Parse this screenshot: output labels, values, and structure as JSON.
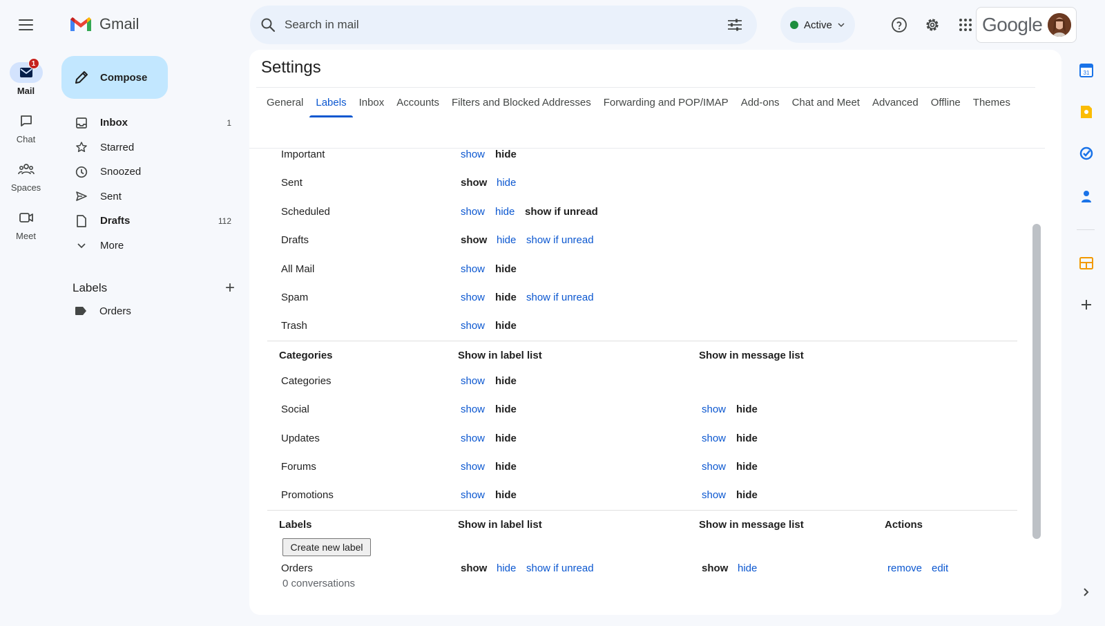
{
  "app": {
    "name": "Gmail"
  },
  "rail": {
    "items": [
      {
        "label": "Mail",
        "badge": "1"
      },
      {
        "label": "Chat"
      },
      {
        "label": "Spaces"
      },
      {
        "label": "Meet"
      }
    ]
  },
  "compose": {
    "label": "Compose"
  },
  "nav": {
    "items": [
      {
        "label": "Inbox",
        "count": "1",
        "icon": "inbox-icon"
      },
      {
        "label": "Starred",
        "count": "",
        "icon": "star-icon"
      },
      {
        "label": "Snoozed",
        "count": "",
        "icon": "clock-icon"
      },
      {
        "label": "Sent",
        "count": "",
        "icon": "send-icon"
      },
      {
        "label": "Drafts",
        "count": "112",
        "icon": "draft-icon"
      },
      {
        "label": "More",
        "count": "",
        "icon": "chevron-down-icon"
      }
    ]
  },
  "labels": {
    "title": "Labels",
    "items": [
      {
        "label": "Orders"
      }
    ]
  },
  "search": {
    "placeholder": "Search in mail"
  },
  "status": {
    "label": "Active",
    "color": "#1e8e3e"
  },
  "account": {
    "brand": "Google"
  },
  "settings": {
    "title": "Settings",
    "tabs": [
      "General",
      "Labels",
      "Inbox",
      "Accounts",
      "Filters and Blocked Addresses",
      "Forwarding and POP/IMAP",
      "Add-ons",
      "Chat and Meet",
      "Advanced",
      "Offline",
      "Themes"
    ],
    "active_tab": "Labels",
    "system_labels": [
      {
        "name": "Important",
        "options": [
          "show",
          "hide"
        ],
        "selected": "hide"
      },
      {
        "name": "Sent",
        "options": [
          "show",
          "hide"
        ],
        "selected": "show"
      },
      {
        "name": "Scheduled",
        "options": [
          "show",
          "hide",
          "show if unread"
        ],
        "selected": "show if unread"
      },
      {
        "name": "Drafts",
        "options": [
          "show",
          "hide",
          "show if unread"
        ],
        "selected": "show"
      },
      {
        "name": "All Mail",
        "options": [
          "show",
          "hide"
        ],
        "selected": "hide"
      },
      {
        "name": "Spam",
        "options": [
          "show",
          "hide",
          "show if unread"
        ],
        "selected": "hide"
      },
      {
        "name": "Trash",
        "options": [
          "show",
          "hide"
        ],
        "selected": "hide"
      }
    ],
    "categories": {
      "header": {
        "name": "Categories",
        "label_list": "Show in label list",
        "message_list": "Show in message list"
      },
      "rows": [
        {
          "name": "Categories",
          "label_options": [
            "show",
            "hide"
          ],
          "label_selected": "hide",
          "message_options": [],
          "message_selected": ""
        },
        {
          "name": "Social",
          "label_options": [
            "show",
            "hide"
          ],
          "label_selected": "hide",
          "message_options": [
            "show",
            "hide"
          ],
          "message_selected": "hide"
        },
        {
          "name": "Updates",
          "label_options": [
            "show",
            "hide"
          ],
          "label_selected": "hide",
          "message_options": [
            "show",
            "hide"
          ],
          "message_selected": "hide"
        },
        {
          "name": "Forums",
          "label_options": [
            "show",
            "hide"
          ],
          "label_selected": "hide",
          "message_options": [
            "show",
            "hide"
          ],
          "message_selected": "hide"
        },
        {
          "name": "Promotions",
          "label_options": [
            "show",
            "hide"
          ],
          "label_selected": "hide",
          "message_options": [
            "show",
            "hide"
          ],
          "message_selected": "hide"
        }
      ]
    },
    "user_labels": {
      "header": {
        "name": "Labels",
        "label_list": "Show in label list",
        "message_list": "Show in message list",
        "actions": "Actions"
      },
      "create_button": "Create new label",
      "rows": [
        {
          "name": "Orders",
          "sub": "0 conversations",
          "label_options": [
            "show",
            "hide",
            "show if unread"
          ],
          "label_selected": "show",
          "message_options": [
            "show",
            "hide"
          ],
          "message_selected": "show",
          "actions": [
            "remove",
            "edit"
          ]
        }
      ]
    }
  },
  "colors": {
    "link": "#0b57d0",
    "accent": "#c2e7ff",
    "badge": "#c5221f"
  }
}
